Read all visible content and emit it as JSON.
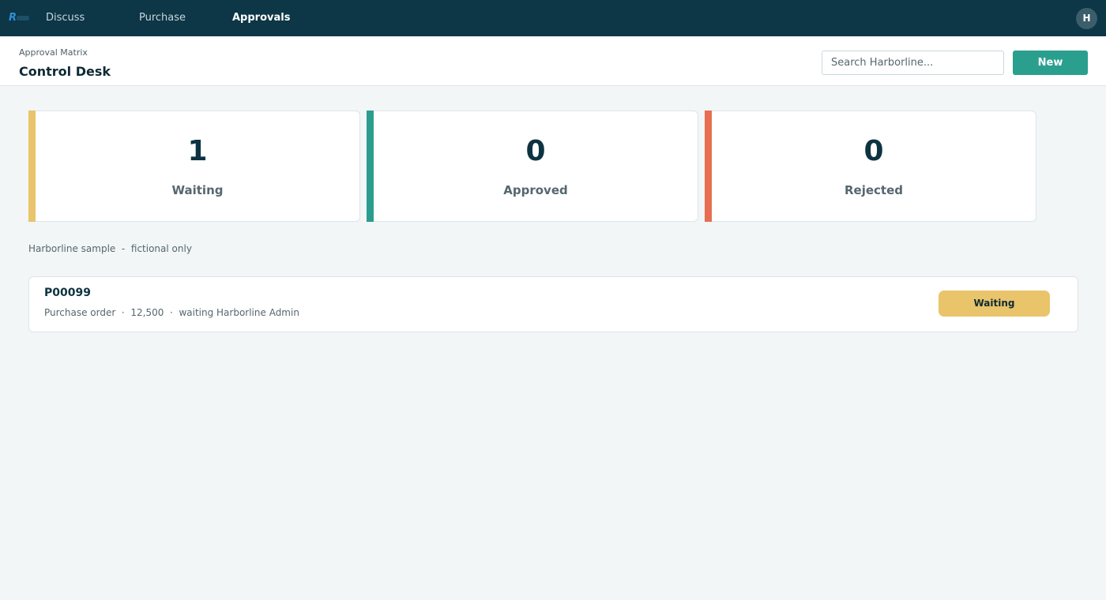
{
  "nav": {
    "items": [
      {
        "label": "Discuss"
      },
      {
        "label": "Purchase"
      },
      {
        "label": "Approvals"
      }
    ],
    "avatar_initial": "H"
  },
  "header": {
    "breadcrumb": "Approval Matrix",
    "title": "Control Desk",
    "search_placeholder": "Search Harborline...",
    "new_label": "New"
  },
  "stats": [
    {
      "value": "1",
      "label": "Waiting",
      "color": "#e9c46a"
    },
    {
      "value": "0",
      "label": "Approved",
      "color": "#2a9d8f"
    },
    {
      "value": "0",
      "label": "Rejected",
      "color": "#e76f51"
    }
  ],
  "note": "Harborline sample  -  fictional only",
  "approvals": [
    {
      "id": "P00099",
      "meta": "Purchase order  ·  12,500  ·  waiting Harborline Admin",
      "status": "Waiting",
      "status_color": "#e9c46a"
    }
  ],
  "icons": {
    "logo": "brand-logo-icon"
  },
  "colors": {
    "topbar": "#0d3646",
    "accent": "#2b9f8e"
  }
}
